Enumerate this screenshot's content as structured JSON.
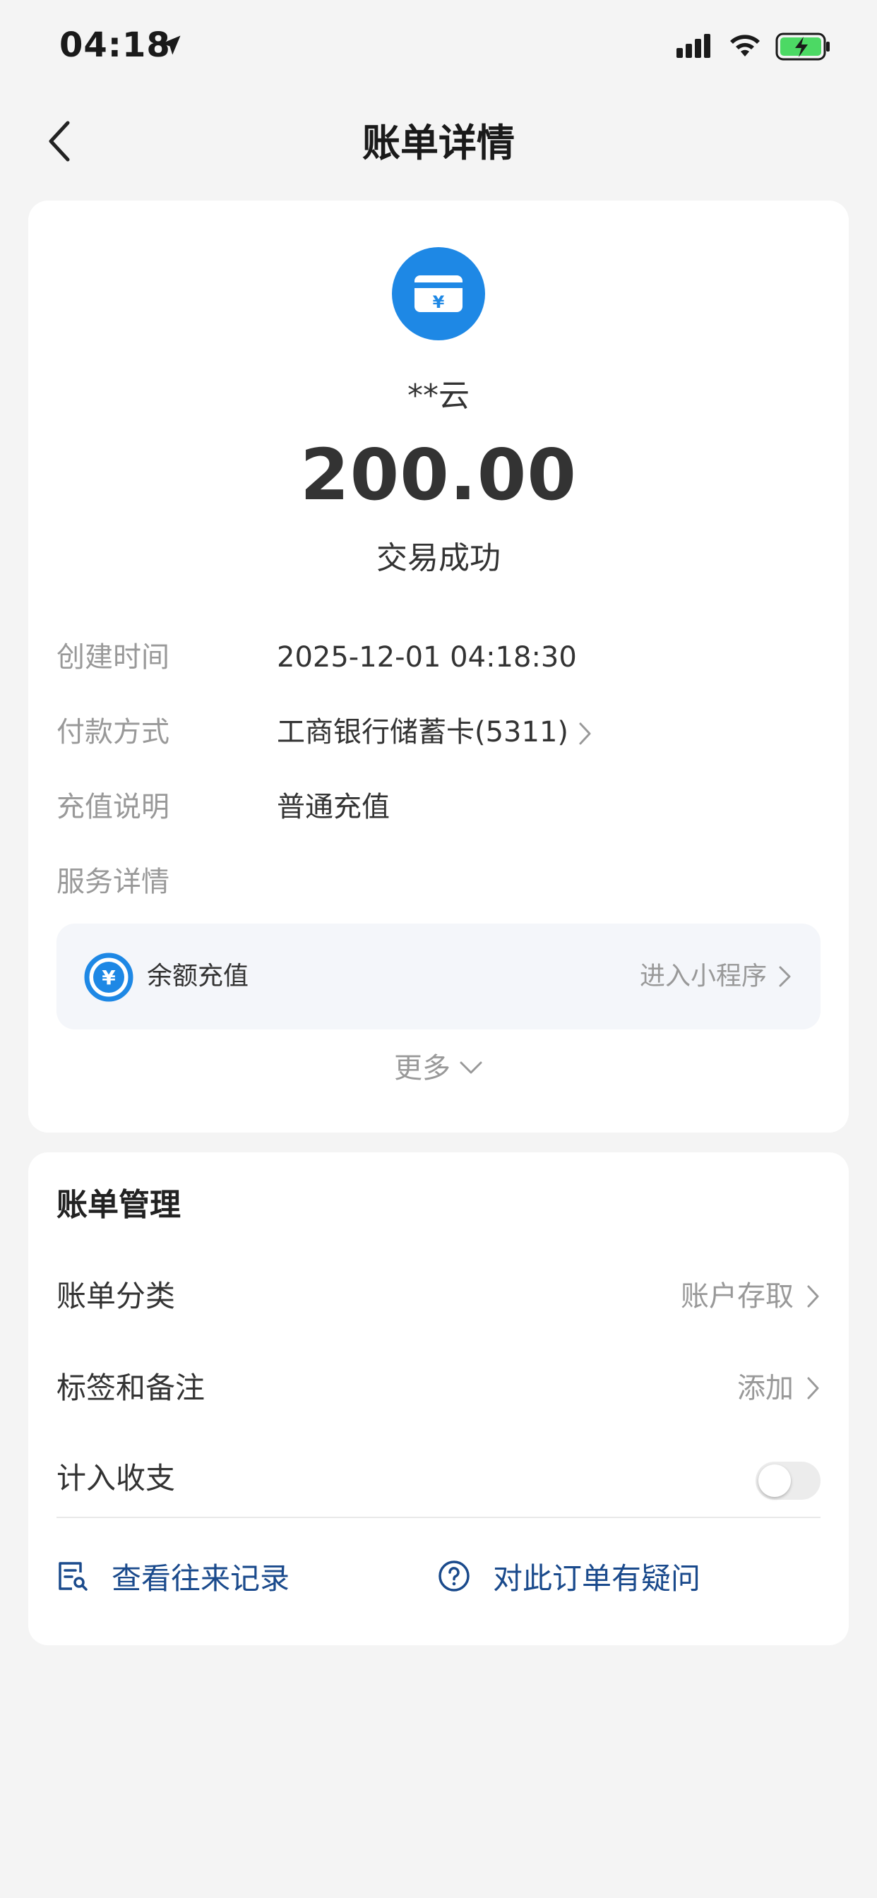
{
  "status_bar": {
    "time": "04:18"
  },
  "header": {
    "title": "账单详情"
  },
  "transaction": {
    "merchant": "**云",
    "amount": "200.00",
    "status": "交易成功",
    "details": [
      {
        "label": "创建时间",
        "value": "2025-12-01 04:18:30"
      },
      {
        "label": "付款方式",
        "value": "工商银行储蓄卡(5311)"
      },
      {
        "label": "充值说明",
        "value": "普通充值"
      },
      {
        "label": "服务详情",
        "value": ""
      }
    ],
    "service": {
      "label": "余额充值",
      "link": "进入小程序"
    },
    "more": "更多"
  },
  "manage": {
    "title": "账单管理",
    "category_label": "账单分类",
    "category_value": "账户存取",
    "tag_label": "标签和备注",
    "tag_value": "添加",
    "count_label": "计入收支",
    "count_enabled": false,
    "records_link": "查看往来记录",
    "question_link": "对此订单有疑问"
  },
  "colors": {
    "accent": "#1e88e5",
    "link": "#1a4a8c",
    "background": "#f4f4f4",
    "battery": "#4cd964"
  },
  "icons": [
    "location-arrow-icon",
    "signal-icon",
    "wifi-icon",
    "battery-charging-icon",
    "back-chevron-icon",
    "wallet-yuan-icon",
    "yuan-circle-icon",
    "chevron-right-icon",
    "chevron-down-icon",
    "record-search-icon",
    "question-circle-icon"
  ]
}
